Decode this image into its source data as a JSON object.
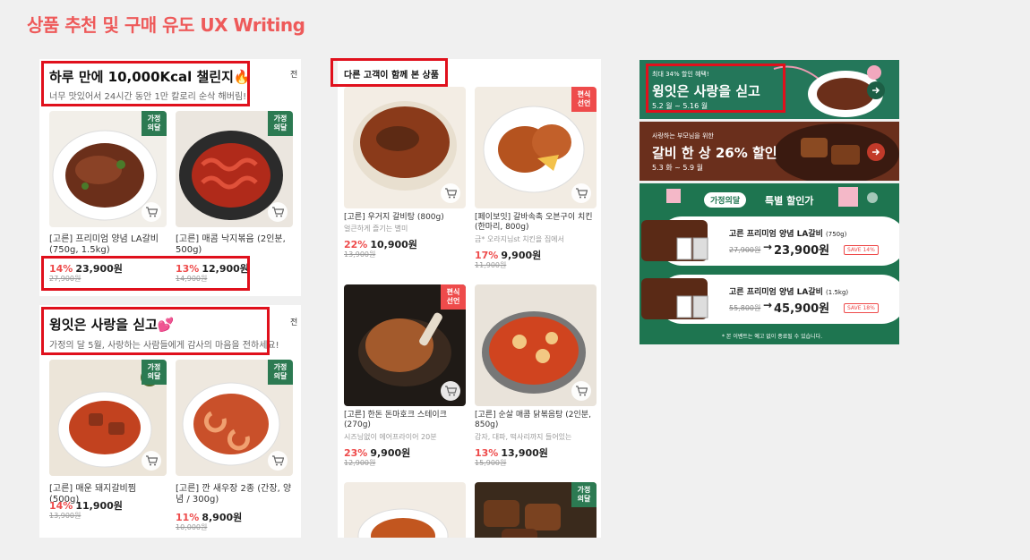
{
  "page_title": "상품 추천 및 구매 유도 UX Writing",
  "panel_left": {
    "section1": {
      "title": "하루 만에 10,000Kcal 챌린지🔥",
      "subtitle": "너무 맛있어서 24시간 동안 1만 칼로리 순삭 해버림!",
      "peek": "전",
      "products": [
        {
          "badge": "가정\n의달",
          "name": "[고른] 프리미엄 양념 LA갈비 (750g, 1.5kg)",
          "rate": "14%",
          "price": "23,900원",
          "orig": "27,900원"
        },
        {
          "badge": "가정\n의달",
          "name": "[고른] 매콤 낙지볶음 (2인분, 500g)",
          "rate": "13%",
          "price": "12,900원",
          "orig": "14,900원"
        }
      ]
    },
    "section2": {
      "title": "윙잇은 사랑을 싣고💕",
      "subtitle": "가정의 달 5월, 사랑하는 사람들에게 감사의 마음을 전하세요!",
      "peek": "전",
      "products": [
        {
          "badge": "가정\n의달",
          "name": "[고른] 매운 돼지갈비찜 (500g)",
          "rate": "14%",
          "price": "11,900원",
          "orig": "13,900원"
        },
        {
          "badge": "가정\n의달",
          "name": "[고른] 깐 새우장 2종 (간장, 양념 / 300g)",
          "rate": "11%",
          "price": "8,900원",
          "orig": "10,000원"
        }
      ]
    }
  },
  "panel_mid": {
    "title": "다른 고객이 함께 본 상품",
    "products": [
      {
        "badge": "",
        "name": "[고른] 우거지 갈비탕 (800g)",
        "desc": "얼큰하게 즐기는 별미",
        "rate": "22%",
        "price": "10,900원",
        "orig": "13,900원"
      },
      {
        "badge": "편식\n선언",
        "name": "[페이보잇] 갈바속촉 오븐구이 치킨 (한마리, 800g)",
        "desc": "금* 오라지님st 치킨을 집에서",
        "rate": "17%",
        "price": "9,900원",
        "orig": "11,900원"
      },
      {
        "badge": "편식\n선언",
        "name": "[고른] 한돈 돈마호크 스테이크 (270g)",
        "desc": "시즈닝없이 에어프라이어 20분",
        "rate": "23%",
        "price": "9,900원",
        "orig": "12,900원"
      },
      {
        "badge": "",
        "name": "[고른] 순살 매콤 닭볶음탕 (2인분, 850g)",
        "desc": "감자, 대파, 떡사리까지 들어있는",
        "rate": "13%",
        "price": "13,900원",
        "orig": "15,900원"
      },
      {
        "badge": "",
        "name": "",
        "desc": "",
        "rate": "",
        "price": "",
        "orig": ""
      },
      {
        "badge": "가정\n의달",
        "name": "",
        "desc": "",
        "rate": "",
        "price": "",
        "orig": ""
      }
    ]
  },
  "banners": {
    "b1": {
      "small": "최대 34% 할인 혜택!",
      "big": "윙잇은 사랑을 싣고",
      "date": "5.2 월 ~ 5.16 월"
    },
    "b2": {
      "small": "사랑하는 부모님을 위한",
      "big": "갈비 한 상 26% 할인",
      "date": "5.3 화 ~ 5.9 월"
    },
    "b3": {
      "tag": "가정의달",
      "title": "특별 할인가",
      "items": [
        {
          "name": "고른 프리미엄 양념 LA갈비",
          "size": "(750g)",
          "orig": "27,900원",
          "arrow": "→",
          "price": "23,900원",
          "save": "SAVE 14%"
        },
        {
          "name": "고른 프리미엄 양념 LA갈비",
          "size": "(1.5kg)",
          "orig": "55,800원",
          "arrow": "→",
          "price": "45,900원",
          "save": "SAVE 18%"
        }
      ],
      "note": "* 본 이벤트는 예고 없이 종료될 수 있습니다."
    }
  },
  "colors": {
    "accent_red": "#ee4b4b",
    "highlight": "#e0101c",
    "green_badge": "#2c7a52",
    "title_coral": "#ee5a5a"
  }
}
